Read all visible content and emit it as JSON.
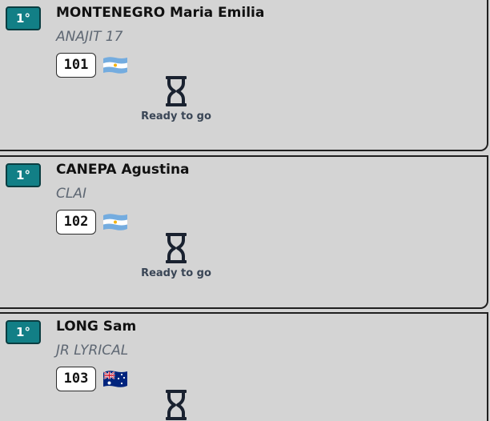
{
  "entries": [
    {
      "rank": "1°",
      "name": "MONTENEGRO Maria Emilia",
      "club": "ANAJIT 17",
      "bib": "101",
      "flag_icon": "argentina-flag-icon",
      "status_icon": "hourglass-icon",
      "status": "Ready to go"
    },
    {
      "rank": "1°",
      "name": "CANEPA Agustina",
      "club": "CLAI",
      "bib": "102",
      "flag_icon": "argentina-flag-icon",
      "status_icon": "hourglass-icon",
      "status": "Ready to go"
    },
    {
      "rank": "1°",
      "name": "LONG Sam",
      "club": "JR LYRICAL",
      "bib": "103",
      "flag_icon": "australia-flag-icon",
      "status_icon": "hourglass-icon",
      "status": ""
    }
  ],
  "colors": {
    "rank_badge": "#127f86",
    "background": "#d4d4d4",
    "club_text": "#5e6773",
    "status_text": "#3a4656"
  }
}
